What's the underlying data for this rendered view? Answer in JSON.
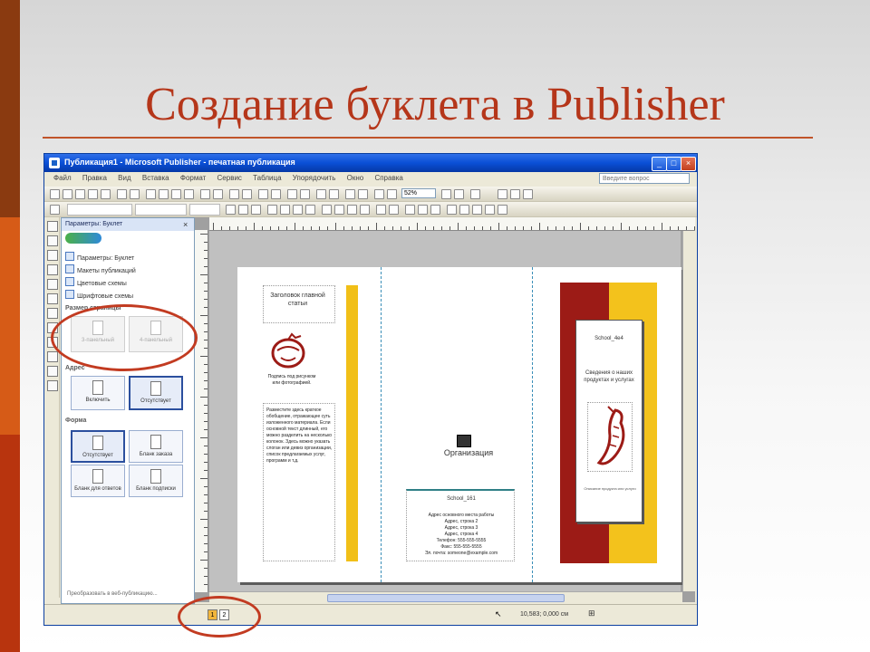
{
  "slide": {
    "title": "Создание буклета в Publisher",
    "accent_color": "#b5361a"
  },
  "window": {
    "title": "Публикация1 - Microsoft Publisher - печатная публикация",
    "buttons": {
      "minimize": "_",
      "maximize": "□",
      "close": "×"
    }
  },
  "menubar": {
    "items": [
      "Файл",
      "Правка",
      "Вид",
      "Вставка",
      "Формат",
      "Сервис",
      "Таблица",
      "Упорядочить",
      "Окно",
      "Справка"
    ],
    "help_placeholder": "Введите вопрос"
  },
  "toolbar": {
    "zoom": "52%"
  },
  "task_pane": {
    "title": "Параметры: Буклет",
    "close": "×",
    "links": [
      "Параметры: Буклет",
      "Макеты публикаций",
      "Цветовые схемы",
      "Шрифтовые схемы"
    ],
    "page_size_heading": "Размер страницы",
    "page_size_options": [
      "3-панельный",
      "4-панельный"
    ],
    "address_heading": "Адрес",
    "address_options": [
      "Включить",
      "Отсутствует"
    ],
    "form_heading": "Форма",
    "form_options": [
      "Отсутствует",
      "Бланк заказа",
      "Бланк для ответов",
      "Бланк подписки"
    ],
    "footer": "Преобразовать в веб-публикацию..."
  },
  "publication": {
    "col1": {
      "heading": "Заголовок главной статьи",
      "tomato_caption": "Подпись под рисунком или фотографией.",
      "body_text": "Разместите здесь краткое обобщение, отражающее суть изложенного материала. Если основной текст длинный, его можно разделить на несколько колонок. Здесь можно указать слоган или девиз организации, список предлагаемых услуг, программ и т.д."
    },
    "col2": {
      "org_name": "Организация",
      "school": "School_161",
      "details": [
        "Адрес основного места работы",
        "Адрес, строка 2",
        "Адрес, строка 3",
        "Адрес, строка 4",
        "Телефон: 555-555-5555",
        "Факс: 555-555-5555",
        "Эл. почта: someone@example.com"
      ]
    },
    "col3": {
      "school": "School_4e4",
      "caption": "Сведения о наших продуктах и услугах",
      "small_text": "Описание продукта или услуги"
    },
    "colors": {
      "red_band": "#9c1b16",
      "yellow_band": "#f3c21c"
    }
  },
  "statusbar": {
    "pages": [
      "1",
      "2"
    ],
    "coordinates": "10,583; 0,000 см",
    "cursor": "↖"
  }
}
